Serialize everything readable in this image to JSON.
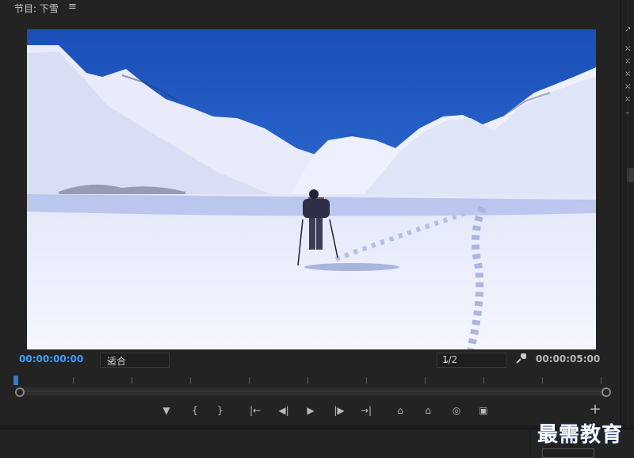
{
  "header": {
    "title": "节目: 下雪"
  },
  "viewer": {
    "content": "snowy mountain valley with hiker"
  },
  "footer": {
    "timecode_current": "00:00:00:00",
    "fit_select_value": "适合",
    "resolution_select_value": "1/2",
    "timecode_total": "00:00:05:00"
  },
  "controls": {
    "buttons": [
      {
        "name": "add-marker"
      },
      {
        "name": "mark-in"
      },
      {
        "name": "mark-out"
      },
      {
        "name": "go-to-in"
      },
      {
        "name": "step-back"
      },
      {
        "name": "play"
      },
      {
        "name": "step-forward"
      },
      {
        "name": "go-to-out"
      },
      {
        "name": "lift"
      },
      {
        "name": "extract"
      },
      {
        "name": "export-frame"
      },
      {
        "name": "compare-view"
      }
    ],
    "plus_label": "+"
  },
  "watermark": {
    "text": "最需教育"
  },
  "colors": {
    "accent": "#3f9cff",
    "panel": "#232323",
    "bg": "#1b1b1b"
  }
}
